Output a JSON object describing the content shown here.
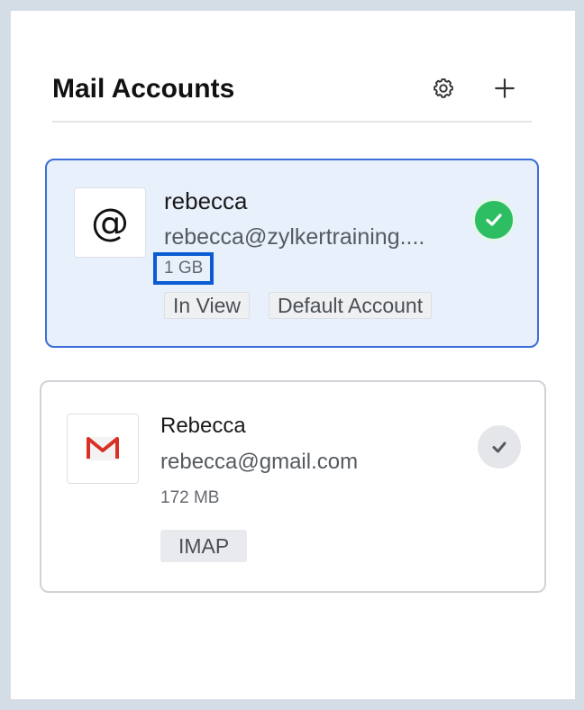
{
  "header": {
    "title": "Mail Accounts",
    "settings_icon": "gear-icon",
    "add_icon": "plus-icon"
  },
  "accounts": [
    {
      "name": "rebecca",
      "email": "rebecca@zylkertraining....",
      "size": "1 GB",
      "icon": "at-sign-icon",
      "avatar_glyph": "@",
      "tags": [
        "In View",
        "Default Account"
      ],
      "selected": true,
      "status_icon": "check-circle-icon"
    },
    {
      "name": "Rebecca",
      "email": "rebecca@gmail.com",
      "size": "172 MB",
      "icon": "gmail-icon",
      "tags": [
        "IMAP"
      ],
      "selected": false,
      "status_icon": "check-circle-icon"
    }
  ],
  "colors": {
    "selected_card_bg": "#e8f0fc",
    "selected_card_border": "#3c6fd8",
    "highlight_box": "#0b5bd3",
    "check_active": "#2dbd63",
    "check_inactive": "#e4e6e9",
    "gmail_red": "#d93025"
  }
}
